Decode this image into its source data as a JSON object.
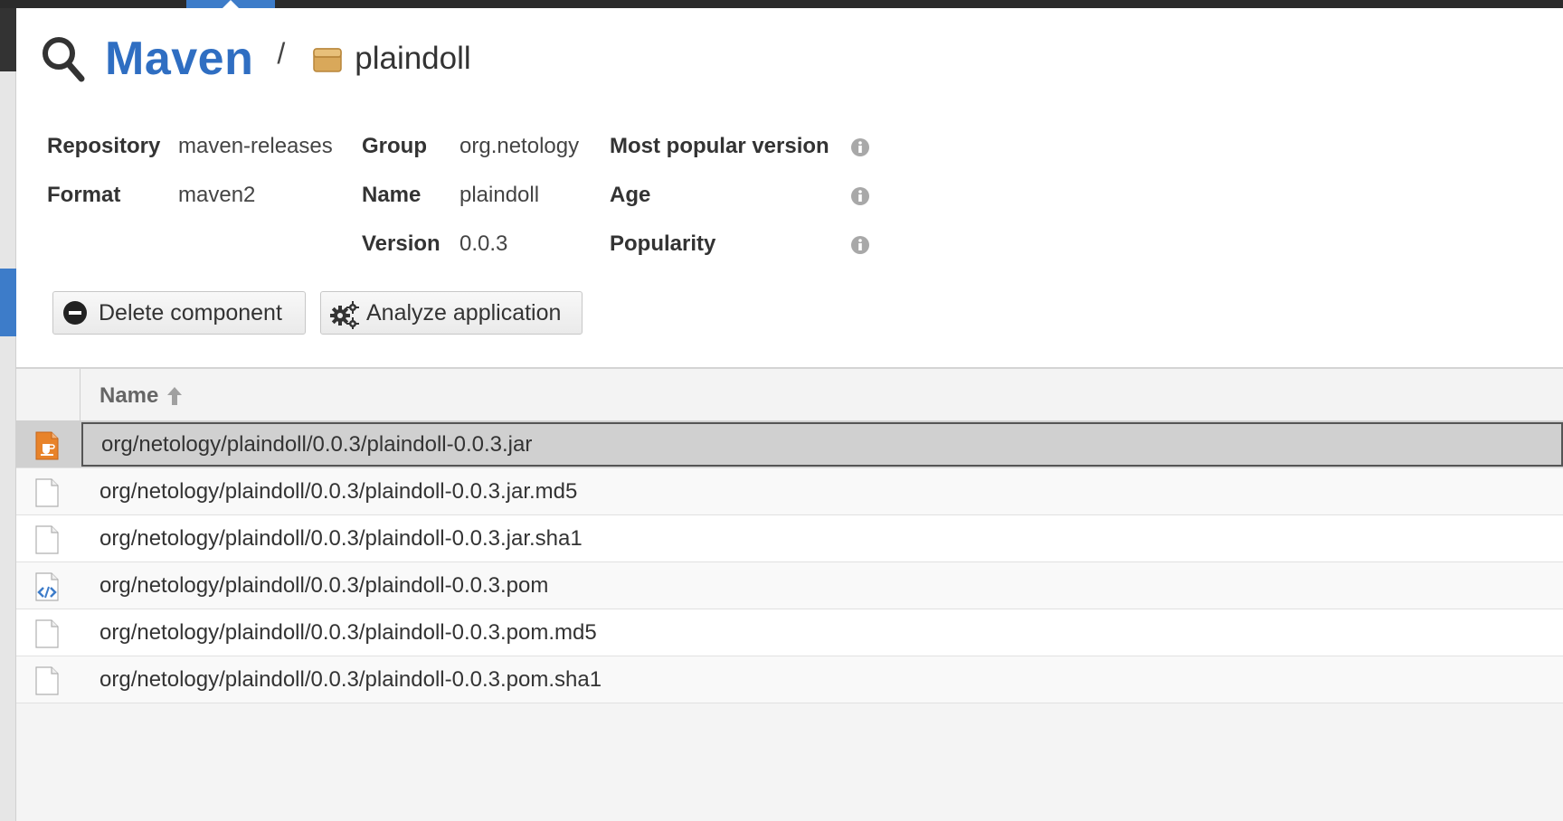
{
  "header": {
    "root": "Maven",
    "separator": "/",
    "current": "plaindoll"
  },
  "properties": {
    "repository_label": "Repository",
    "repository_value": "maven-releases",
    "format_label": "Format",
    "format_value": "maven2",
    "group_label": "Group",
    "group_value": "org.netology",
    "name_label": "Name",
    "name_value": "plaindoll",
    "version_label": "Version",
    "version_value": "0.0.3",
    "most_popular_label": "Most popular version",
    "age_label": "Age",
    "popularity_label": "Popularity"
  },
  "buttons": {
    "delete": "Delete component",
    "analyze": "Analyze application"
  },
  "grid": {
    "column_name": "Name",
    "rows": [
      {
        "name": "org/netology/plaindoll/0.0.3/plaindoll-0.0.3.jar",
        "icon": "jar-file-icon",
        "selected": true
      },
      {
        "name": "org/netology/plaindoll/0.0.3/plaindoll-0.0.3.jar.md5",
        "icon": "file-icon",
        "selected": false
      },
      {
        "name": "org/netology/plaindoll/0.0.3/plaindoll-0.0.3.jar.sha1",
        "icon": "file-icon",
        "selected": false
      },
      {
        "name": "org/netology/plaindoll/0.0.3/plaindoll-0.0.3.pom",
        "icon": "xml-file-icon",
        "selected": false
      },
      {
        "name": "org/netology/plaindoll/0.0.3/plaindoll-0.0.3.pom.md5",
        "icon": "file-icon",
        "selected": false
      },
      {
        "name": "org/netology/plaindoll/0.0.3/plaindoll-0.0.3.pom.sha1",
        "icon": "file-icon",
        "selected": false
      }
    ]
  },
  "colors": {
    "accent": "#2f6ec2",
    "selected_row": "#d0d0d0",
    "jar_icon": "#e8832a"
  }
}
